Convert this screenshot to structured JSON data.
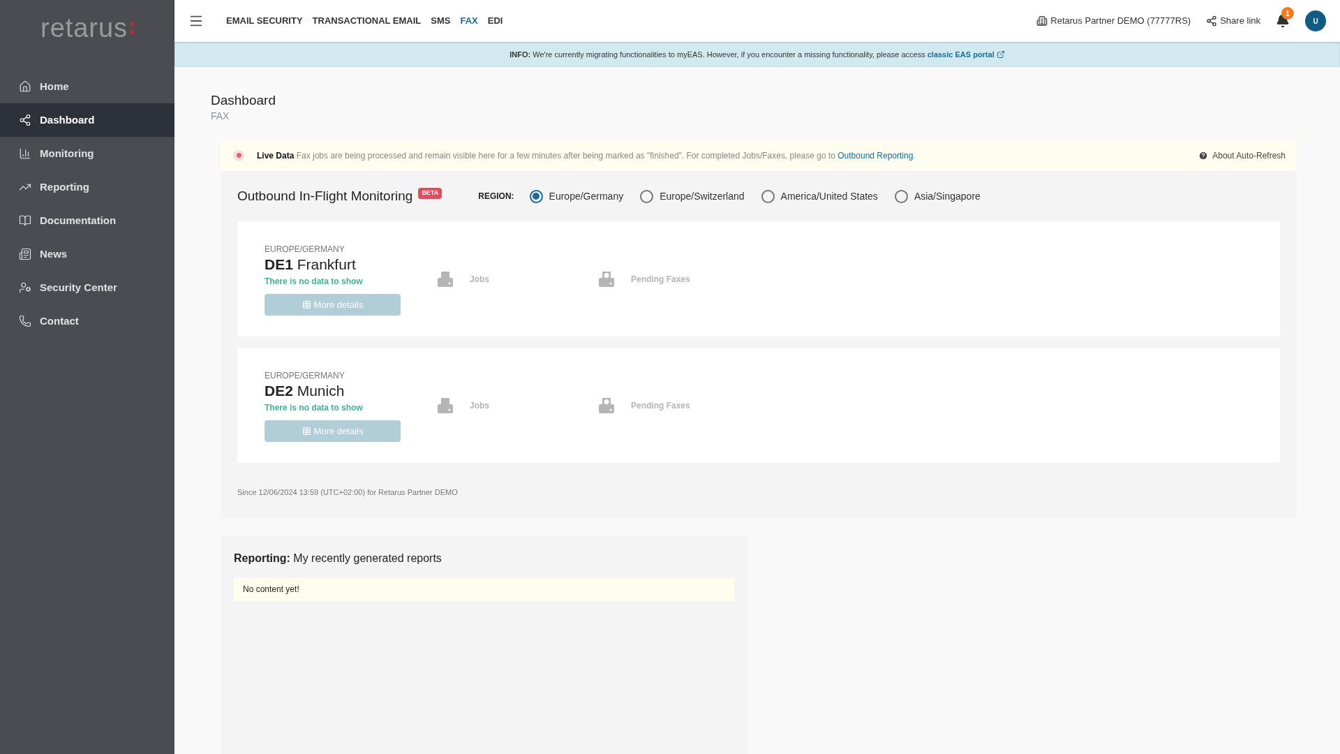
{
  "sidebar": {
    "logo": "retarus",
    "items": [
      {
        "label": "Home",
        "selected": false
      },
      {
        "label": "Dashboard",
        "selected": true
      },
      {
        "label": "Monitoring",
        "selected": false
      },
      {
        "label": "Reporting",
        "selected": false
      },
      {
        "label": "Documentation",
        "selected": false
      },
      {
        "label": "News",
        "selected": false
      },
      {
        "label": "Security Center",
        "selected": false
      },
      {
        "label": "Contact",
        "selected": false
      }
    ]
  },
  "top_nav": {
    "tabs": [
      {
        "label": "EMAIL SECURITY",
        "selected": false
      },
      {
        "label": "TRANSACTIONAL EMAIL",
        "selected": false
      },
      {
        "label": "SMS",
        "selected": false
      },
      {
        "label": "FAX",
        "selected": true
      },
      {
        "label": "EDI",
        "selected": false
      }
    ],
    "account": "Retarus Partner DEMO (77777RS)",
    "share": "Share link",
    "notifications": "1",
    "avatar": "U"
  },
  "info_banner": {
    "text": "**INFO:** We're currently migrating functionalities to myEAS. However, if you encounter a missing functionality, please access ",
    "link": "classic EAS portal"
  },
  "page": {
    "title": "Dashboard",
    "subtitle": "FAX"
  },
  "live_data": {
    "text": "**Live Data** Fax jobs are being processed and remain visible here for a few minutes after being marked as \"finished\". For completed Jobs/Faxes, please go to ",
    "link": "Outbound Reporting",
    "suffix": ".",
    "help": "About Auto-Refresh"
  },
  "monitoring": {
    "title": "Outbound In-Flight Monitoring",
    "badge": "BETA",
    "region_label": "REGION:",
    "regions": [
      {
        "label": "Europe/Germany",
        "selected": true
      },
      {
        "label": "Europe/Switzerland",
        "selected": false
      },
      {
        "label": "America/United States",
        "selected": false
      },
      {
        "label": "Asia/Singapore",
        "selected": false
      }
    ],
    "sites": [
      {
        "region": "EUROPE/GERMANY",
        "name": "**DE1** Frankfurt",
        "status": "There is no data to show",
        "button": "More details",
        "jobs": "Jobs",
        "pending": "Pending Faxes"
      },
      {
        "region": "EUROPE/GERMANY",
        "name": "**DE2** Munich",
        "status": "There is no data to show",
        "button": "More details",
        "jobs": "Jobs",
        "pending": "Pending Faxes"
      }
    ],
    "footer": "Since 12/06/2024 13:59 (UTC+02:00) for Retarus Partner DEMO"
  },
  "reporting": {
    "title": "**Reporting:** My recently generated reports",
    "empty": "No content yet!"
  }
}
